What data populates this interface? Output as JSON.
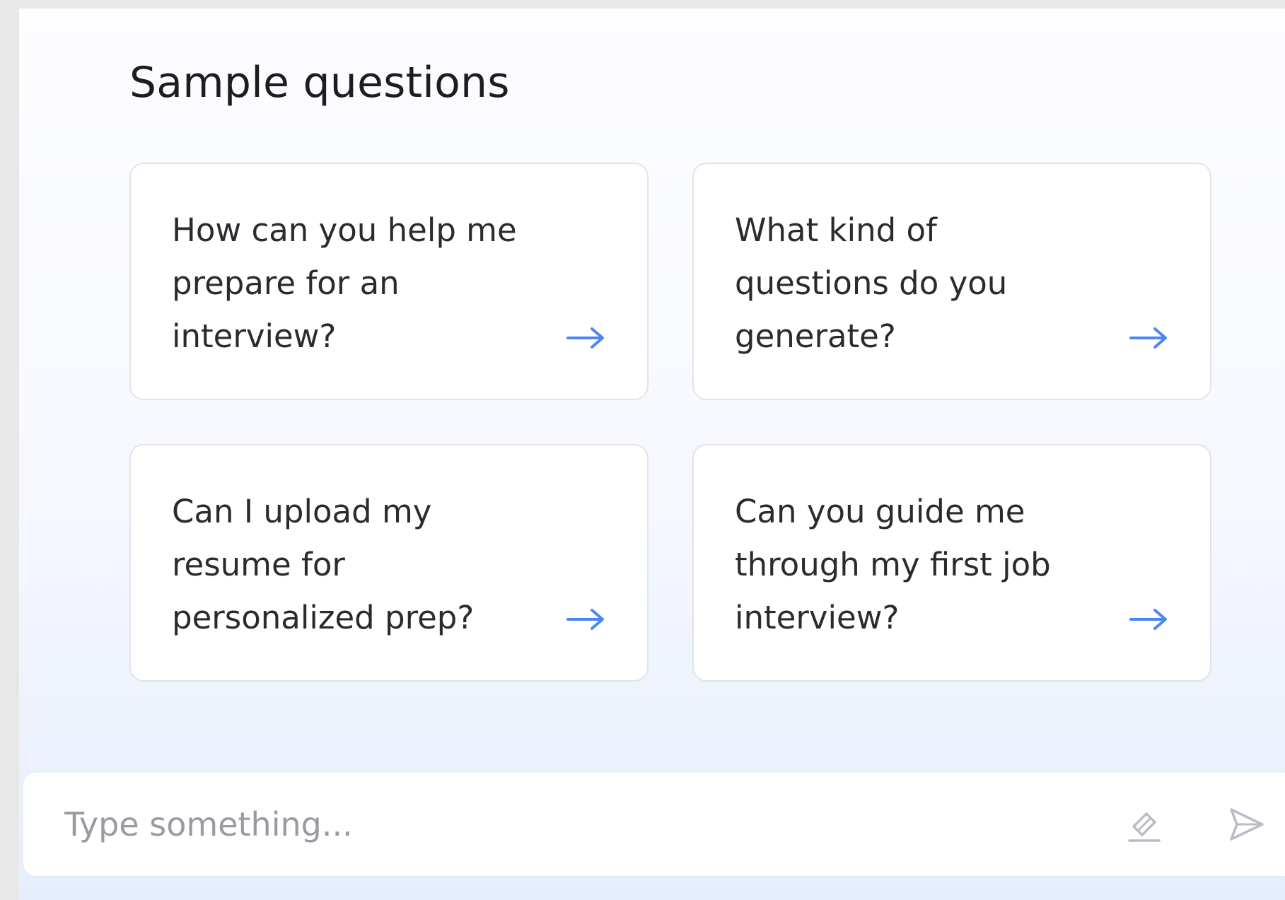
{
  "section": {
    "title": "Sample questions"
  },
  "questions": [
    {
      "text": "How can you help me prepare for an interview?"
    },
    {
      "text": "What kind of questions do you generate?"
    },
    {
      "text": "Can I upload my resume for personalized prep?"
    },
    {
      "text": "Can you guide me through my first job interview?"
    }
  ],
  "input": {
    "placeholder": "Type something...",
    "value": ""
  },
  "icons": {
    "card_arrow": "arrow-right-icon",
    "clear": "eraser-icon",
    "send": "send-icon"
  },
  "colors": {
    "accent": "#4a86f7",
    "muted_icon": "#b9bcc6"
  }
}
